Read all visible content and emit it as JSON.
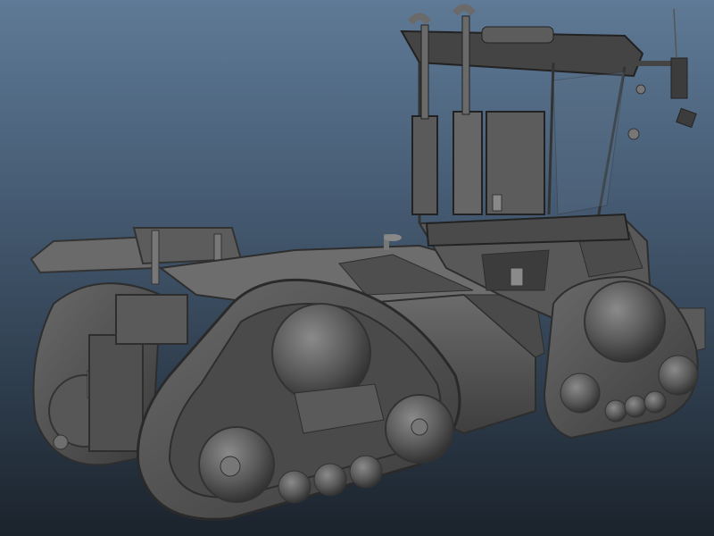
{
  "scene": {
    "subject": "tracked-tractor-model",
    "colors": {
      "background_top": "#5f7a96",
      "background_bottom": "#1b232c",
      "body_dark": "#3b3b3b",
      "body_mid": "#555555",
      "body_light": "#777777",
      "track": "#4e4e4e",
      "highlight": "#8e8e8e"
    }
  }
}
